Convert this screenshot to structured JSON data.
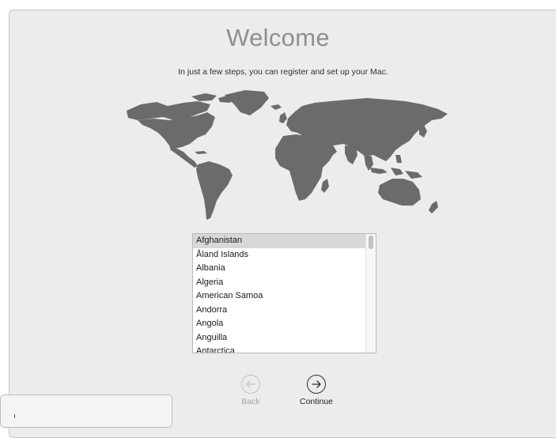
{
  "welcome": {
    "title": "Welcome",
    "subtitle": "In just a few steps, you can register and set up your Mac."
  },
  "country_list": {
    "selected": "Afghanistan",
    "items": [
      "Afghanistan",
      "Åland Islands",
      "Albania",
      "Algeria",
      "American Samoa",
      "Andorra",
      "Angola",
      "Anguilla",
      "Antarctica"
    ]
  },
  "navigation": {
    "back_label": "Back",
    "continue_label": "Continue"
  },
  "colors": {
    "window_bg": "#ececec",
    "map_fill": "#6b6b6b",
    "selection_bg": "#d8d8d8"
  },
  "icons": {
    "back": "arrow-left-circle-icon",
    "continue": "arrow-right-circle-icon"
  }
}
